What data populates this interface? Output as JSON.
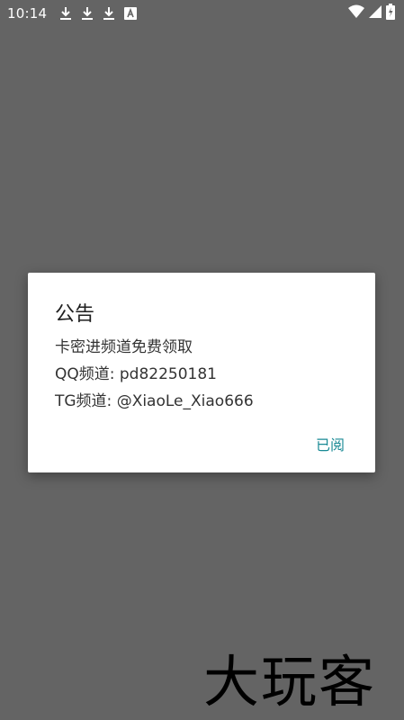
{
  "status_bar": {
    "time": "10:14",
    "notification_icons": [
      "download-icon",
      "download-icon",
      "download-icon",
      "app-a-icon"
    ],
    "right_icons": [
      "wifi-icon",
      "signal-icon",
      "battery-charging-icon"
    ]
  },
  "dialog": {
    "title": "公告",
    "lines": [
      "卡密进频道免费领取",
      "QQ频道: pd82250181",
      "TG频道: @XiaoLe_Xiao666"
    ],
    "button_label": "已阅"
  },
  "watermark": {
    "text": "大玩客"
  },
  "colors": {
    "overlay": "#646464",
    "dialog_background": "#ffffff",
    "accent": "#1a8a95"
  }
}
